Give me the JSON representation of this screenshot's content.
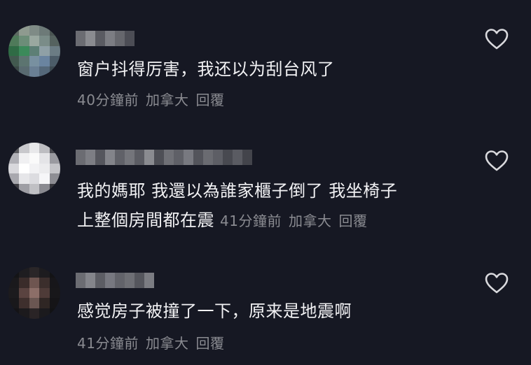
{
  "comments": [
    {
      "text": "窗户抖得厉害，我还以为刮台风了",
      "time": "40分鐘前",
      "location": "加拿大",
      "reply": "回覆"
    },
    {
      "text_line1": "我的媽耶 我還以為誰家櫃子倒了 我坐椅子",
      "text_line2": "上整個房間都在震",
      "time": "41分鐘前",
      "location": "加拿大",
      "reply": "回覆"
    },
    {
      "text": "感觉房子被撞了一下，原来是地震啊",
      "time": "41分鐘前",
      "location": "加拿大",
      "reply": "回覆"
    }
  ],
  "icons": {
    "like": "heart-outline-icon"
  },
  "colors": {
    "background": "#161823",
    "text": "#f2f2f4",
    "meta": "#8a8b91"
  }
}
